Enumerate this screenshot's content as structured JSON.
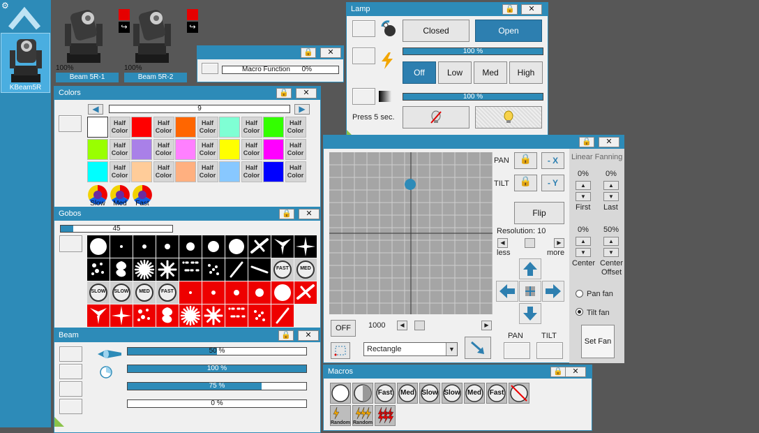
{
  "sidebar": {
    "gear_icon": "gear-icon",
    "fixture_label": "KBeam5R"
  },
  "tiles": [
    {
      "pct": "100%",
      "name": "Beam 5R-1"
    },
    {
      "pct": "100%",
      "name": "Beam 5R-2"
    }
  ],
  "macro_function": {
    "label": "Macro Function",
    "value": "0%"
  },
  "lamp": {
    "title": "Lamp",
    "closed": "Closed",
    "open": "Open",
    "bar1": "100 %",
    "off": "Off",
    "low": "Low",
    "med": "Med",
    "high": "High",
    "bar2": "100 %",
    "press": "Press 5 sec."
  },
  "colors": {
    "title": "Colors",
    "value": "9",
    "half": [
      "Half",
      "Color"
    ],
    "slow": "Slow",
    "med": "Med",
    "fast": "Fast"
  },
  "gobos": {
    "title": "Gobos",
    "value": "45",
    "fraction": 0.11,
    "slow": "SLOW",
    "med": "MED",
    "fast": "FAST"
  },
  "beam": {
    "title": "Beam",
    "bars": [
      {
        "text": "50 %",
        "fraction": 0.5
      },
      {
        "text": "100 %",
        "fraction": 1.0
      },
      {
        "text": "75 %",
        "fraction": 0.75
      },
      {
        "text": "0 %",
        "fraction": 0.0
      }
    ]
  },
  "position": {
    "pan": "PAN",
    "tilt": "TILT",
    "minus_x": "- X",
    "minus_y": "- Y",
    "flip": "Flip",
    "resolution": "Resolution: 10",
    "less": "less",
    "more": "more",
    "off": "OFF",
    "speed": "1000",
    "shape": "Rectangle",
    "pan_bottom": "PAN",
    "tilt_bottom": "TILT",
    "linear_fanning": "Linear Fanning",
    "first_pct": "0%",
    "last_pct": "0%",
    "first": "First",
    "last": "Last",
    "center_pct": "0%",
    "offset_pct": "50%",
    "center": "Center",
    "center_offset_1": "Center",
    "center_offset_2": "Offset",
    "pan_fan": "Pan fan",
    "tilt_fan": "Tilt fan",
    "set_fan": "Set Fan"
  },
  "macros": {
    "title": "Macros",
    "fast": "Fast",
    "med": "Med",
    "slow": "Slow",
    "random": "Random"
  },
  "colors_hex": {
    "accent": "#2d8bb8",
    "background": "#575757"
  }
}
